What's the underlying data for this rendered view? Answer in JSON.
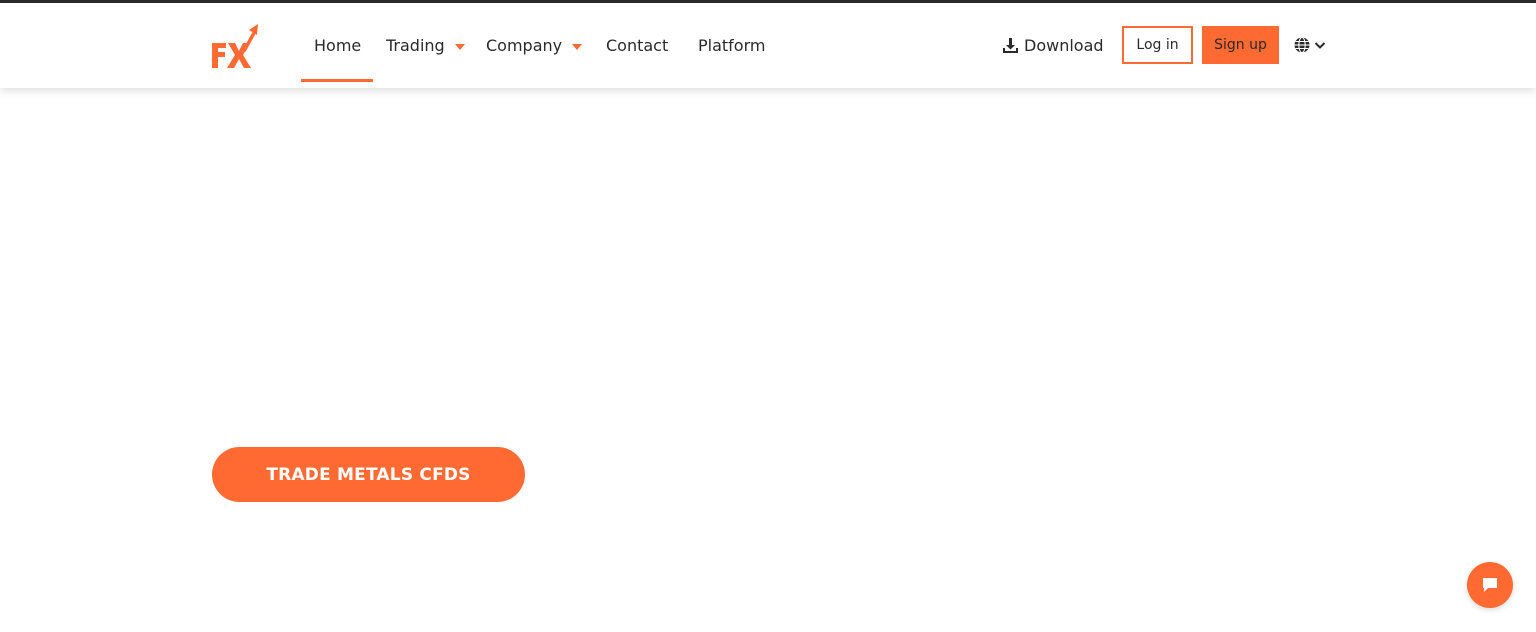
{
  "colors": {
    "accent": "#ff6a33",
    "text": "#2a2a2a",
    "top_line": "#2b2b2b"
  },
  "logo": {
    "text": "FX",
    "icon": "fx-logo-arrow-icon"
  },
  "nav": {
    "home": "Home",
    "trading": "Trading",
    "company": "Company",
    "contact": "Contact",
    "platform": "Platform",
    "active": "Home"
  },
  "header_actions": {
    "download": "Download",
    "download_icon": "download-icon",
    "login": "Log in",
    "signup": "Sign up",
    "language_icon": "globe-icon"
  },
  "hero": {
    "cta_label": "TRADE METALS CFDS"
  },
  "chat": {
    "icon": "chat-bubble-icon"
  }
}
